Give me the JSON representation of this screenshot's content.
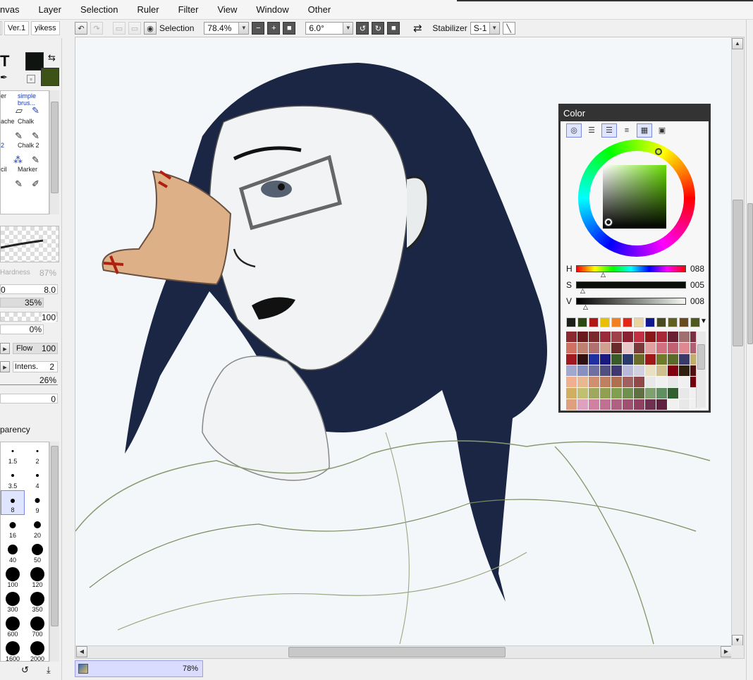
{
  "menubar": {
    "items": [
      "nvas",
      "Layer",
      "Selection",
      "Ruler",
      "Filter",
      "View",
      "Window",
      "Other"
    ]
  },
  "doc_tabs": [
    "Ver.1",
    "yikess"
  ],
  "toolbar": {
    "selection_label": "Selection",
    "zoom": "78.4%",
    "rotation": "6.0°",
    "stabilizer_label": "Stabilizer",
    "stabilizer_value": "S-1"
  },
  "colors": {
    "main": "#0f1410",
    "sub": "#3d5216",
    "accent": "#7a8ae0",
    "canvas_bg": "#f3f7fa"
  },
  "tools": [
    {
      "label": "er",
      "icon": "eraser-icon"
    },
    {
      "label": "simple brus...",
      "icon": "brush-icon"
    },
    {
      "label": "ache",
      "icon": "pen-icon"
    },
    {
      "label": "Chalk",
      "icon": "chalk-icon"
    },
    {
      "label": "2",
      "icon": "spray-icon"
    },
    {
      "label": "Chalk 2",
      "icon": "chalk-icon"
    },
    {
      "label": "cil",
      "icon": "pencil-icon"
    },
    {
      "label": "Marker",
      "icon": "marker-icon"
    }
  ],
  "brush_params": {
    "hardness_label": "Hardness",
    "hardness_value": "87%",
    "size_left": "0",
    "size_value": "8.0",
    "min_size": "35%",
    "density": "100",
    "blend": "0%",
    "flow_label": "Flow",
    "flow_value": "100",
    "intens_label": "Intens.",
    "intens_value": "2",
    "persistence": "26%",
    "extra": "0",
    "transparency_label": "parency"
  },
  "brush_sizes": [
    "1.5",
    "2",
    "3.5",
    "4",
    "8",
    "9",
    "16",
    "20",
    "40",
    "50",
    "100",
    "120",
    "300",
    "350",
    "600",
    "700",
    "1600",
    "2000"
  ],
  "statusbar": {
    "zoom": "78%"
  },
  "color_panel": {
    "title": "Color",
    "h_label": "H",
    "h_value": "088",
    "s_label": "S",
    "s_value": "005",
    "v_label": "V",
    "v_value": "008",
    "tabs": [
      "color-wheel-icon",
      "rgb-sliders-icon",
      "hsv-sliders-icon",
      "palette-list-icon",
      "swatches-icon",
      "scratchpad-icon"
    ],
    "top_swatches": [
      "#1b1f17",
      "#2c4a10",
      "#b01818",
      "#e8c000",
      "#f08020",
      "#e02818",
      "#e8d4a0",
      "#101890",
      "#4a4a20",
      "#606020",
      "#6a4a20",
      "#505a20"
    ],
    "palette": [
      [
        "#8a2a30",
        "#6a1a1a",
        "#7a2a2a",
        "#9a2a3a",
        "#a04048",
        "#8a2030",
        "#c03040",
        "#8a1818",
        "#a82838",
        "#6a2030",
        "#a07070",
        "#7a3040"
      ],
      [
        "#d07060",
        "#c08070",
        "#b07070",
        "#d0a090",
        "#6a2a2a",
        "#e8c8c8",
        "#7a3a3a",
        "#e0a0a0",
        "#d07080",
        "#c06070",
        "#e08890",
        "#b06070"
      ],
      [
        "#a01820",
        "#301010",
        "#2030a0",
        "#1a1a80",
        "#3a5a2a",
        "#2a3a6a",
        "#6a6a2a",
        "#a01818",
        "#707a2a",
        "#5a6a2a",
        "#3a3a6a",
        "#c0b070"
      ],
      [
        "#a0a8d0",
        "#8890c0",
        "#7070a0",
        "#505080",
        "#403870",
        "#b8b8d8",
        "#d0d0e0",
        "#e8e0c0",
        "#d0c090",
        "#800010",
        "#302010",
        "#501010"
      ],
      [
        "#f0b090",
        "#e8b890",
        "#d09070",
        "#c08060",
        "#b07050",
        "#a06060",
        "#904848",
        "#e8e8e8",
        "#f0f0f0",
        "#e8e8e8",
        "#f0f0f0",
        "#700010"
      ],
      [
        "#d0b060",
        "#c0c070",
        "#a0a860",
        "#90a050",
        "#80a050",
        "#709050",
        "#607040",
        "#80a070",
        "#609060",
        "#306030",
        "#e8e8e8",
        "#f0f0f0"
      ],
      [
        "#e0a080",
        "#e0a0c0",
        "#d080a0",
        "#c07090",
        "#b06080",
        "#a05070",
        "#904060",
        "#703050",
        "#602040",
        "#f0f0f0",
        "#e8e8e8",
        "#f0f0f0"
      ]
    ]
  }
}
